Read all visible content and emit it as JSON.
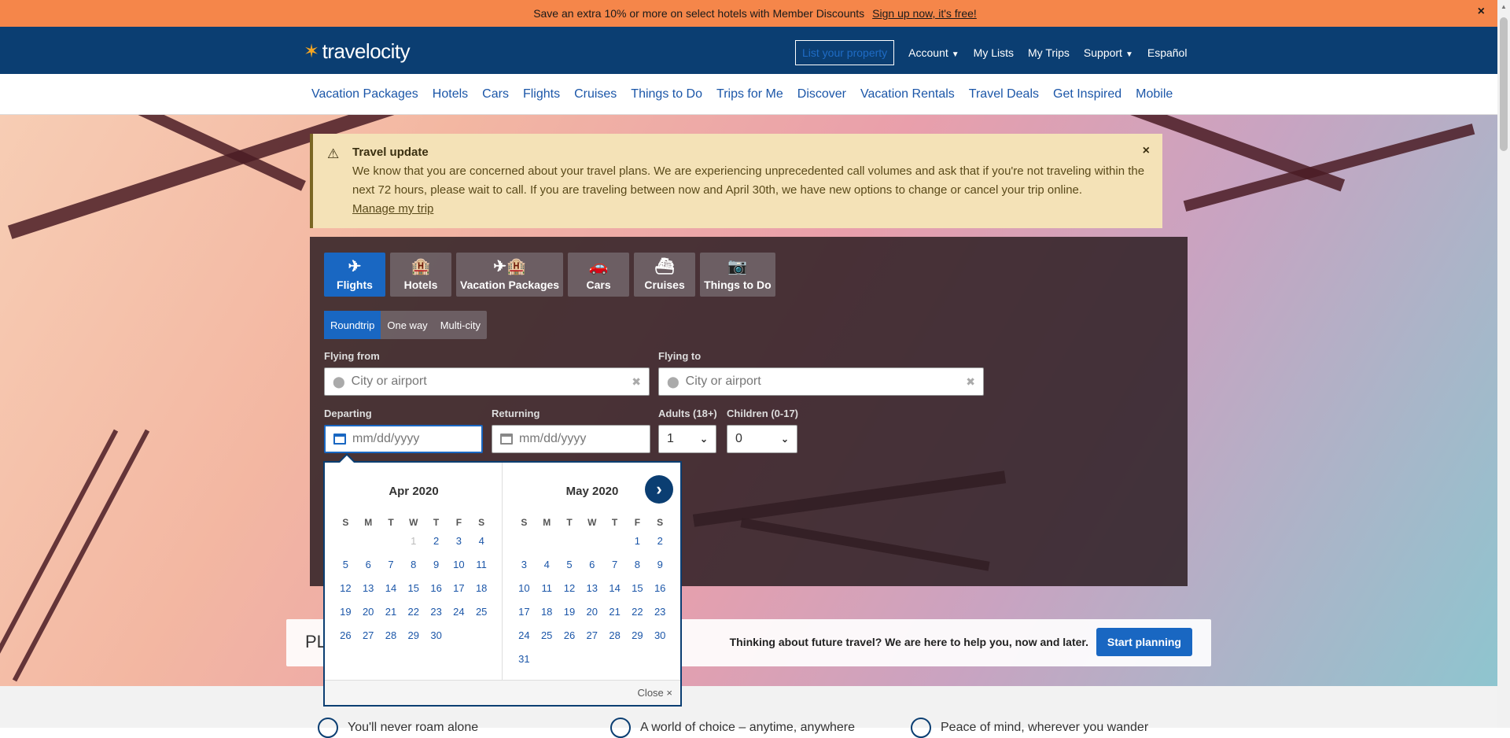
{
  "promo": {
    "text": "Save an extra 10% or more on select hotels with Member Discounts",
    "link": "Sign up now, it's free!",
    "close": "×"
  },
  "header": {
    "logo": "travelocity",
    "list_property": "List your property",
    "account": "Account",
    "my_lists": "My Lists",
    "my_trips": "My Trips",
    "support": "Support",
    "language": "Español"
  },
  "nav": [
    "Vacation Packages",
    "Hotels",
    "Cars",
    "Flights",
    "Cruises",
    "Things to Do",
    "Trips for Me",
    "Discover",
    "Vacation Rentals",
    "Travel Deals",
    "Get Inspired",
    "Mobile"
  ],
  "alert": {
    "title": "Travel update",
    "body": "We know that you are concerned about your travel plans. We are experiencing unprecedented call volumes and ask that if you're not traveling within the next 72 hours, please wait to call. If you are traveling between now and April 30th, we have new options to change or cancel your trip online.",
    "link": "Manage my trip",
    "close": "×"
  },
  "product_tabs": [
    {
      "label": "Flights",
      "icon": "✈"
    },
    {
      "label": "Hotels",
      "icon": "🏨"
    },
    {
      "label": "Vacation Packages",
      "icon": "✈🏨"
    },
    {
      "label": "Cars",
      "icon": "🚗"
    },
    {
      "label": "Cruises",
      "icon": "⛴"
    },
    {
      "label": "Things to Do",
      "icon": "📷"
    }
  ],
  "trip_types": [
    "Roundtrip",
    "One way",
    "Multi-city"
  ],
  "form": {
    "flying_from_label": "Flying from",
    "flying_from_placeholder": "City or airport",
    "flying_to_label": "Flying to",
    "flying_to_placeholder": "City or airport",
    "departing_label": "Departing",
    "departing_placeholder": "mm/dd/yyyy",
    "returning_label": "Returning",
    "returning_placeholder": "mm/dd/yyyy",
    "adults_label": "Adults (18+)",
    "adults_value": "1",
    "children_label": "Children (0-17)",
    "children_value": "0"
  },
  "calendar": {
    "dow": [
      "S",
      "M",
      "T",
      "W",
      "T",
      "F",
      "S"
    ],
    "month1": {
      "title": "Apr 2020",
      "offset": 3,
      "days": 30,
      "disabled_through": 1
    },
    "month2": {
      "title": "May 2020",
      "offset": 5,
      "days": 31,
      "disabled_through": 0
    },
    "close": "Close ×"
  },
  "planning": {
    "prefix": "PL",
    "text": "Thinking about future travel? We are here to help you, now and later.",
    "button": "Start planning"
  },
  "features": [
    "You'll never roam alone",
    "A world of choice – anytime, anywhere",
    "Peace of mind, wherever you wander"
  ]
}
